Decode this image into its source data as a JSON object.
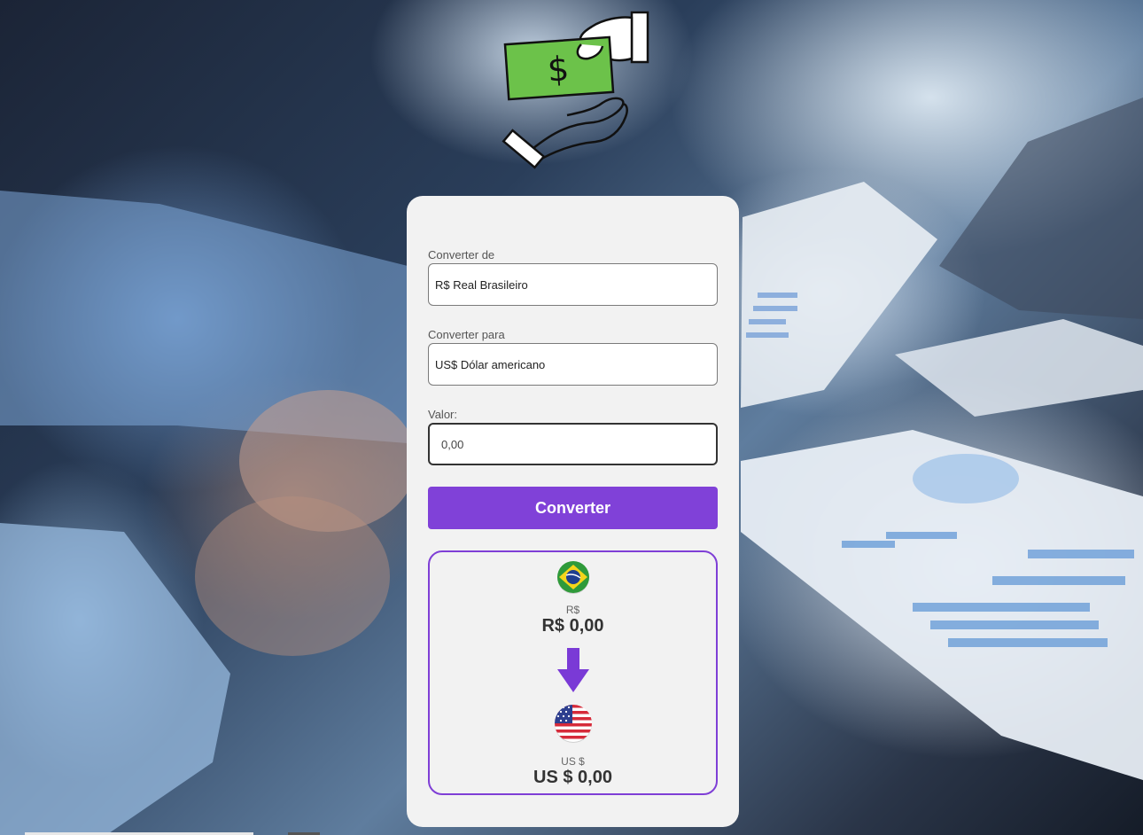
{
  "form": {
    "from_label": "Converter de",
    "from_value": "R$ Real Brasileiro",
    "to_label": "Converter para",
    "to_value": "US$ Dólar americano",
    "amount_label": "Valor:",
    "amount_placeholder": "0,00",
    "convert_button": "Converter"
  },
  "result": {
    "from_code": "R$",
    "from_value": "R$ 0,00",
    "to_code": "US $",
    "to_value": "US $ 0,00"
  },
  "icons": {
    "logo": "money-exchange-hands-icon",
    "from_flag": "brazil-flag-icon",
    "arrow": "arrow-down-icon",
    "to_flag": "usa-flag-icon"
  },
  "colors": {
    "accent": "#8041d8",
    "bill_green": "#6cc24a",
    "card_bg": "#f2f2f2"
  }
}
